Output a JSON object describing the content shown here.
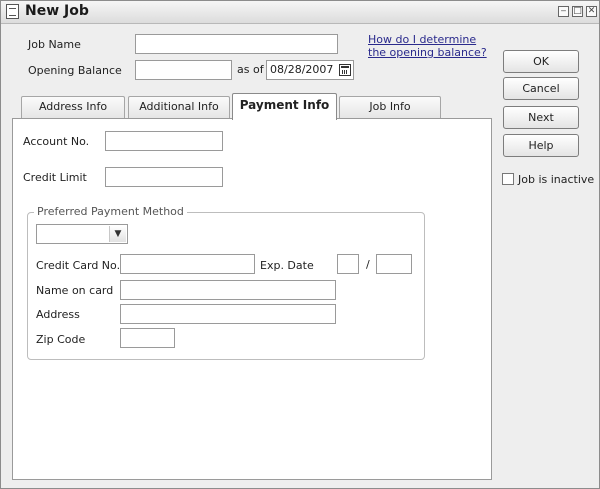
{
  "window": {
    "title": "New Job",
    "controls": {
      "minimize": "‒",
      "restore": "□",
      "close": "✕"
    }
  },
  "top_form": {
    "job_name_label": "Job Name",
    "job_name_value": "",
    "opening_balance_label": "Opening Balance",
    "opening_balance_value": "",
    "as_of_label": "as of",
    "as_of_date": "08/28/2007",
    "help_link": "How do I determine the opening balance?"
  },
  "buttons": {
    "ok": "OK",
    "cancel": "Cancel",
    "next": "Next",
    "help": "Help"
  },
  "inactive_checkbox": {
    "label": "Job is inactive",
    "checked": false
  },
  "tabs": [
    {
      "label": "Address Info",
      "active": false
    },
    {
      "label": "Additional Info",
      "active": false
    },
    {
      "label": "Payment Info",
      "active": true
    },
    {
      "label": "Job Info",
      "active": false
    }
  ],
  "payment": {
    "account_no_label": "Account No.",
    "account_no_value": "",
    "credit_limit_label": "Credit Limit",
    "credit_limit_value": "",
    "group_title": "Preferred Payment Method",
    "method_value": "",
    "credit_card_label": "Credit Card No.",
    "credit_card_value": "",
    "exp_date_label": "Exp. Date",
    "exp_month": "",
    "exp_separator": "/",
    "exp_year": "",
    "name_on_card_label": "Name on card",
    "name_on_card_value": "",
    "address_label": "Address",
    "address_value": "",
    "zip_label": "Zip Code",
    "zip_value": ""
  }
}
